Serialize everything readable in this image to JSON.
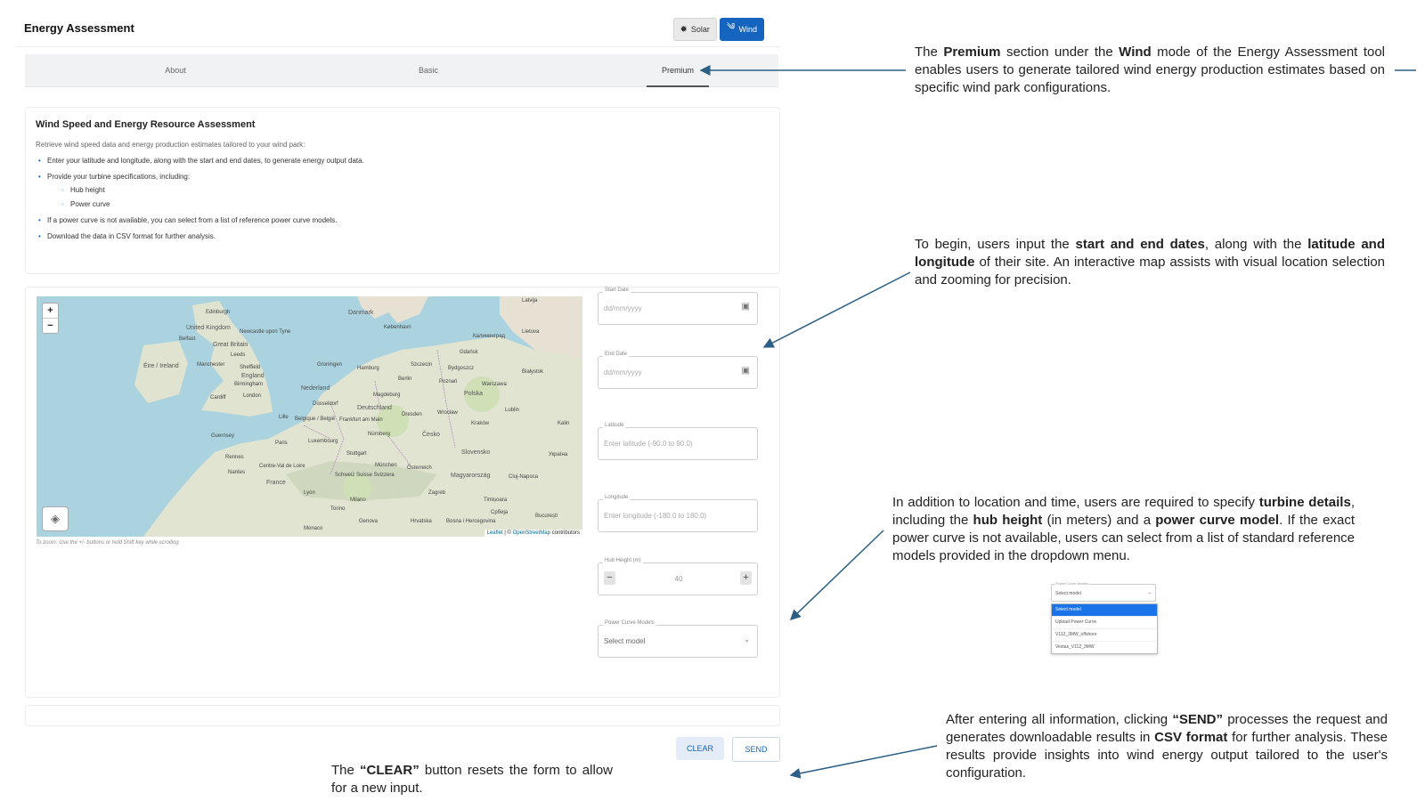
{
  "app": {
    "title": "Energy Assessment",
    "modes": {
      "solar": "Solar",
      "wind": "Wind",
      "active": "Wind"
    },
    "tabs": [
      "About",
      "Basic",
      "Premium"
    ],
    "active_tab": "Premium",
    "accent_color": "#1565c0"
  },
  "info": {
    "title": "Wind Speed and Energy Resource Assessment",
    "subtitle": "Retrieve wind speed data and energy production estimates tailored to your wind park:",
    "bullets": [
      "Enter your latitude and longitude, along with the start and end dates, to generate energy output data.",
      "Provide your turbine specifications, including:",
      "If a power curve is not available, you can select from a list of reference power curve models.",
      "Download the data in CSV format for further analysis."
    ],
    "sub_bullets": [
      "Hub height",
      "Power curve"
    ]
  },
  "map": {
    "zoom_in": "+",
    "zoom_out": "−",
    "attribution_leaflet": "Leaflet",
    "attribution_sep": " | © ",
    "attribution_osm": "OpenStreetMap",
    "attribution_tail": " contributors",
    "hint": "To zoom: Use the +/- buttons or hold Shift key while scrolling",
    "labels": {
      "latvija": "Latvija",
      "edinburgh": "Edinburgh",
      "danmark": "Danmark",
      "kobenhavn": "København",
      "lietuva": "Lietuva",
      "kaliningrad": "Калининград",
      "united_kingdom": "United Kingdom",
      "newcastle": "Newcastle upon Tyne",
      "belfast": "Belfast",
      "great_britain": "Great Britain",
      "leeds": "Leeds",
      "eire": "Éire / Ireland",
      "manchester": "Manchester",
      "sheffield": "Sheffield",
      "england": "England",
      "birmingham": "Birmingham",
      "cardiff": "Cardiff",
      "london": "London",
      "groningen": "Groningen",
      "hamburg": "Hamburg",
      "szczecin": "Szczecin",
      "bydgoszcz": "Bydgoszcz",
      "gdansk": "Gdańsk",
      "bialystok": "Białystok",
      "nederland": "Nederland",
      "berlin": "Berlin",
      "poznan": "Poznań",
      "warszawa": "Warszawa",
      "polska": "Polska",
      "dusseldorf": "Düsseldorf",
      "magdeburg": "Magdeburg",
      "deutschland": "Deutschland",
      "dresden": "Dresden",
      "wroclaw": "Wrocław",
      "lublin": "Lublin",
      "lille": "Lille",
      "belgique": "Belgique / België",
      "frankfurt": "Frankfurt am Main",
      "krakow": "Kraków",
      "luxembourg": "Luxembourg",
      "nurnberg": "Nürnberg",
      "cesko": "Česko",
      "slovensko": "Slovensko",
      "guernsey": "Guernsey",
      "paris": "Paris",
      "rennes": "Rennes",
      "stuttgart": "Stuttgart",
      "munchen": "München",
      "osterreich": "Österreich",
      "nantes": "Nantes",
      "centre_val": "Centre-Val de Loire",
      "schweiz": "Schweiz Suisse Svizzera",
      "magyarorszag": "Magyarország",
      "france": "France",
      "lyon": "Lyon",
      "milano": "Milano",
      "torino": "Torino",
      "zagreb": "Zagreb",
      "cluj": "Cluj-Napoca",
      "timisoara": "Timișoara",
      "srbija": "Србија",
      "bucuresti": "București",
      "genova": "Genova",
      "bosna": "Bosna i Hercegovina",
      "hrvatska": "Hrvatska",
      "monaco": "Monaco",
      "ukraina": "Україна",
      "kalin": "Kalin"
    }
  },
  "form": {
    "start_date": {
      "label": "Start Date",
      "placeholder": "dd/mm/yyyy"
    },
    "end_date": {
      "label": "End Date",
      "placeholder": "dd/mm/yyyy"
    },
    "latitude": {
      "label": "Latitude",
      "placeholder": "Enter latitude (-90.0 to 90.0)"
    },
    "longitude": {
      "label": "Longitude",
      "placeholder": "Enter longitude (-180.0 to 180.0)"
    },
    "hub_height": {
      "label": "Hub Height (m)",
      "value": "40",
      "minus": "−",
      "plus": "+"
    },
    "power_curve": {
      "label": "Power Curve Models",
      "value": "Select model"
    }
  },
  "buttons": {
    "clear": "CLEAR",
    "send": "SEND"
  },
  "annotations": {
    "premium": {
      "t1": "The ",
      "b1": "Premium",
      "t2": "  section under the ",
      "b2": "Wind",
      "t3": " mode of the Energy Assessment tool enables users to generate tailored wind energy production estimates based on specific wind park configurations."
    },
    "dates": {
      "t1": "To begin, users input the ",
      "b1": "start and end dates",
      "t2": ", along with the ",
      "b2": "latitude and longitude",
      "t3": " of their site. An interactive map assists with visual location selection and zooming for precision."
    },
    "turbine": {
      "t1": "In addition to location and time, users are required to specify ",
      "b1": "turbine details",
      "t2": ", including the ",
      "b2": "hub height",
      "t3": " (in meters) and a ",
      "b3": "power curve model",
      "t4": ". If the exact power curve is not available, users can select from a list of standard reference models provided in the dropdown menu."
    },
    "clear": {
      "t1": "The ",
      "b1": "“CLEAR”",
      "t2": " button resets the form to allow for a new input."
    },
    "send": {
      "t1": "After entering all information, clicking ",
      "b1": "“SEND”",
      "t2": " processes the request and generates downloadable results in ",
      "b2": "CSV format",
      "t3": " for further analysis. These results provide insights into wind energy output tailored to the user's configuration."
    },
    "dropdown_preview": {
      "label": "Power Curve Models",
      "value": "Select model",
      "options": [
        "Select model",
        "Upload Power Curve",
        "V112_3MW_offshore",
        "Vestas_V112_3MW"
      ]
    },
    "arrow_color": "#2b5f85"
  }
}
